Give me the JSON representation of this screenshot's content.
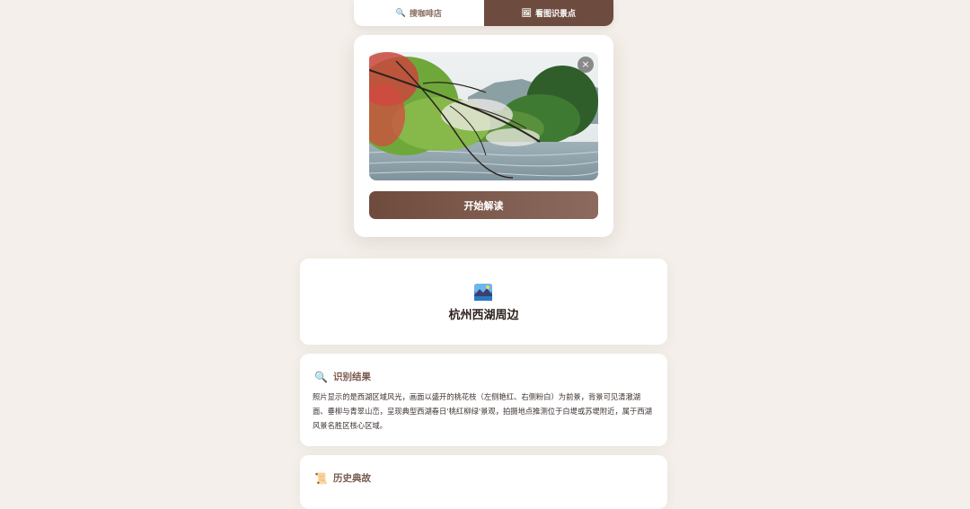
{
  "tabs": [
    {
      "icon": "search-icon",
      "glyph": "🔍",
      "label": "搜咖啡店",
      "active": false
    },
    {
      "icon": "picture-icon",
      "glyph": "🖼",
      "label": "看图识景点",
      "active": true
    }
  ],
  "upload": {
    "close_glyph": "×",
    "start_label": "开始解读"
  },
  "place": {
    "title": "杭州西湖周边"
  },
  "result": {
    "glyph": "🔍",
    "heading": "识别结果",
    "body": "照片显示的是西湖区域风光，画面以盛开的桃花枝（左侧艳红、右侧粉白）为前景，背景可见清澈湖面、垂柳与青翠山峦，呈现典型西湖春日'桃红柳绿'景观，拍摄地点推测位于白堤或苏堤附近，属于西湖风景名胜区核心区域。"
  },
  "history": {
    "glyph": "📜",
    "heading": "历史典故"
  },
  "colors": {
    "background": "#f4efea",
    "accent": "#6d4b3e",
    "button_gradient_end": "#8c6b5e",
    "heading_text": "#7a5a4c"
  }
}
